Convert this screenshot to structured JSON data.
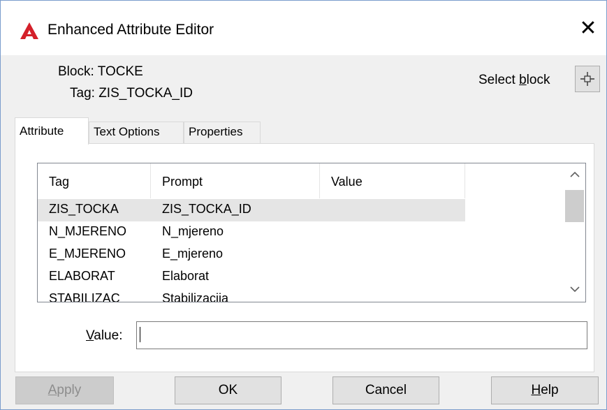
{
  "window": {
    "title": "Enhanced Attribute Editor",
    "close": "✕"
  },
  "info": {
    "block_label": "Block:",
    "block_value": "TOCKE",
    "tag_label": "Tag:",
    "tag_value": "ZIS_TOCKA_ID"
  },
  "select_block": {
    "label_before": "Select ",
    "label_mnemonic": "b",
    "label_after": "lock"
  },
  "tabs": [
    {
      "label": "Attribute"
    },
    {
      "label": "Text Options"
    },
    {
      "label": "Properties"
    }
  ],
  "table": {
    "headers": [
      "Tag",
      "Prompt",
      "Value"
    ],
    "rows": [
      {
        "tag": "ZIS_TOCKA",
        "prompt": "ZIS_TOCKA_ID",
        "value": ""
      },
      {
        "tag": "N_MJERENO",
        "prompt": "N_mjereno",
        "value": ""
      },
      {
        "tag": "E_MJERENO",
        "prompt": "E_mjereno",
        "value": ""
      },
      {
        "tag": "ELABORAT",
        "prompt": "Elaborat",
        "value": ""
      },
      {
        "tag": "STABILIZAC",
        "prompt": "Stabilizacija",
        "value": ""
      }
    ]
  },
  "value_field": {
    "label_mnemonic": "V",
    "label_rest": "alue:",
    "value": ""
  },
  "buttons": {
    "apply_mnemonic": "A",
    "apply_rest": "pply",
    "ok": "OK",
    "cancel": "Cancel",
    "help_mnemonic": "H",
    "help_rest": "elp"
  },
  "colors": {
    "accent_icon": "#d4202a",
    "selected_row": "#e5e5e5"
  }
}
